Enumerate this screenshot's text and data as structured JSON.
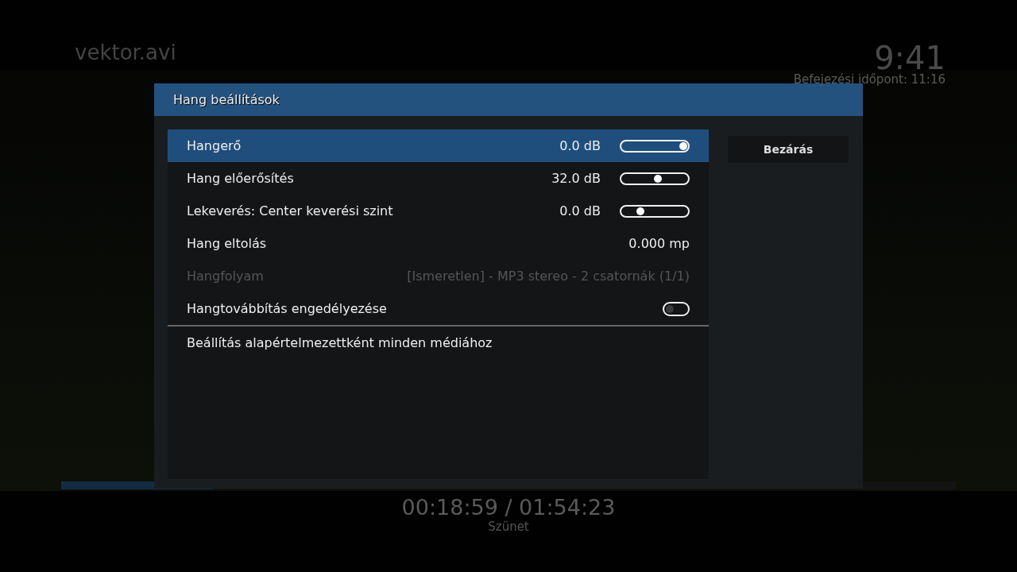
{
  "header": {
    "title": "vektor.avi",
    "clock": "9:41",
    "end_time": "Befejezési időpont: 11:16"
  },
  "dialog": {
    "title": "Hang beállítások",
    "settings": [
      {
        "kind": "slider",
        "label": "Hangerő",
        "value": "0.0 dB",
        "level": 1.0,
        "selected": true,
        "disabled": false
      },
      {
        "kind": "slider",
        "label": "Hang előerősítés",
        "value": "32.0 dB",
        "level": 0.55,
        "selected": false,
        "disabled": false
      },
      {
        "kind": "slider",
        "label": "Lekeverés: Center keverési szint",
        "value": "0.0 dB",
        "level": 0.25,
        "selected": false,
        "disabled": false
      },
      {
        "kind": "value",
        "label": "Hang eltolás",
        "value": "0.000 mp",
        "selected": false,
        "disabled": false
      },
      {
        "kind": "value",
        "label": "Hangfolyam",
        "value": "[Ismeretlen] - MP3 stereo - 2 csatornák (1/1)",
        "selected": false,
        "disabled": true
      },
      {
        "kind": "toggle",
        "label": "Hangtovábbítás engedélyezése",
        "on": false,
        "selected": false,
        "disabled": false
      },
      {
        "kind": "action",
        "label": "Beállítás alapértelmezettként minden médiához",
        "selected": false,
        "disabled": false
      }
    ],
    "buttons": [
      "Bezárás"
    ]
  },
  "playback": {
    "level": 0.17,
    "time": "00:18:59 / 01:54:23",
    "status": "Szünet"
  }
}
